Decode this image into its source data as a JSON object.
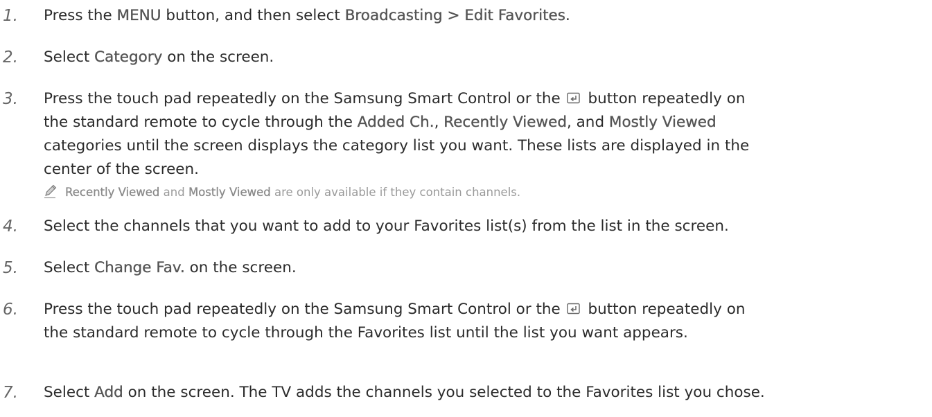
{
  "steps": [
    {
      "number": "1.",
      "parts": [
        "Press the ",
        "MENU",
        " button, and then select ",
        "Broadcasting",
        " > ",
        "Edit Favorites",
        "."
      ]
    },
    {
      "number": "2.",
      "parts": [
        "Select ",
        "Category",
        " on the screen."
      ]
    },
    {
      "number": "3.",
      "lines": [
        [
          "Press the touch pad repeatedly on the Samsung Smart Control or the ",
          " button repeatedly on"
        ],
        [
          "the standard remote to cycle through the ",
          "Added Ch.",
          ", ",
          "Recently Viewed",
          ", and ",
          "Mostly Viewed"
        ],
        [
          "categories until the screen displays the category list you want. These lists are displayed in the"
        ],
        [
          "center of the screen."
        ]
      ],
      "icon": "enter-button-icon",
      "note": {
        "icon": "pencil-note-icon",
        "parts": [
          "Recently Viewed",
          " and ",
          "Mostly Viewed",
          " are only available if they contain channels."
        ]
      }
    },
    {
      "number": "4.",
      "parts": [
        "Select the channels that you want to add to your Favorites list(s) from the list in the screen."
      ]
    },
    {
      "number": "5.",
      "parts": [
        "Select ",
        "Change Fav.",
        " on the screen."
      ]
    },
    {
      "number": "6.",
      "lines": [
        [
          "Press the touch pad repeatedly on the Samsung Smart Control or the ",
          " button repeatedly on"
        ],
        [
          "the standard remote to cycle through the Favorites list until the list you want appears."
        ]
      ],
      "icon": "enter-button-icon"
    },
    {
      "number": "7.",
      "parts": [
        "Select ",
        "Add",
        " on the screen. The TV adds the channels you selected to the Favorites list you chose."
      ]
    }
  ],
  "colors": {
    "text": "#2b2b2b",
    "highlight": "#555555",
    "number": "#666666",
    "note": "#9a9a9a"
  }
}
